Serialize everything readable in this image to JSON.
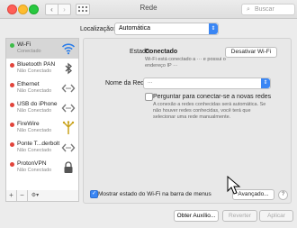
{
  "window": {
    "title": "Rede"
  },
  "toolbar": {
    "back": "‹",
    "forward": "›",
    "search_placeholder": "Buscar"
  },
  "location": {
    "label": "Localização:",
    "value": "Automática"
  },
  "sidebar": {
    "items": [
      {
        "name": "Wi-Fi",
        "status": "Conectado",
        "dot": "green",
        "icon": "wifi-icon"
      },
      {
        "name": "Bluetooth PAN",
        "status": "Não Conectado",
        "dot": "red",
        "icon": "bluetooth-icon"
      },
      {
        "name": "Ethernet",
        "status": "Não Conectado",
        "dot": "red",
        "icon": "ethernet-icon"
      },
      {
        "name": "USB do iPhone",
        "status": "Não Conectado",
        "dot": "red",
        "icon": "iphone-icon"
      },
      {
        "name": "FireWire",
        "status": "Não Conectado",
        "dot": "red",
        "icon": "firewire-icon"
      },
      {
        "name": "Ponte T...derbolt",
        "status": "Não Conectado",
        "dot": "red",
        "icon": "thunderbolt-bridge-icon"
      },
      {
        "name": "ProtonVPN",
        "status": "Não Conectado",
        "dot": "red",
        "icon": "vpn-lock-icon"
      }
    ],
    "add": "+",
    "remove": "−",
    "actions": "⚙▾"
  },
  "detail": {
    "status_label": "Estado:",
    "status_value": "Conectado",
    "disable_button": "Desativar Wi-Fi",
    "status_desc": "Wi-Fi está conectado a ··· e possui o endereço IP ···",
    "network_label": "Nome da Rede:",
    "network_value": "···",
    "ask_label": "Perguntar para conectar-se a novas redes",
    "ask_desc": "A conexão a redes conhecidas será automática. Se não houver redes conhecidas, você terá que selecionar uma rede manualmente.",
    "show_label": "Mostrar estado do Wi-Fi na barra de menus",
    "advanced_button": "Avançado...",
    "help": "?"
  },
  "footer": {
    "assist": "Obter Auxílio...",
    "revert": "Reverter",
    "apply": "Aplicar"
  },
  "colors": {
    "accent": "#3a86f4",
    "connected": "#3cbc48",
    "disconnected": "#e2443b"
  }
}
